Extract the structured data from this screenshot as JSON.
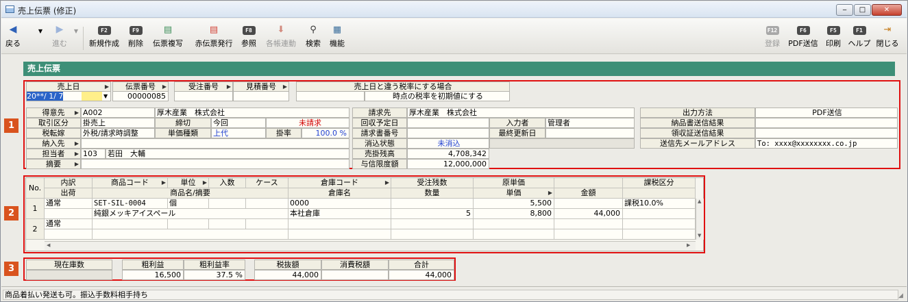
{
  "window": {
    "title": "売上伝票 (修正)",
    "min": "‒",
    "max": "□",
    "close": "✕"
  },
  "toolbar": {
    "back": "戻る",
    "forward": "進む",
    "new_key": "F2",
    "new": "新規作成",
    "delete_key": "F9",
    "delete": "削除",
    "copy": "伝票複写",
    "red": "赤伝票発行",
    "ref_key": "F8",
    "ref": "参照",
    "multi": "各帳連動",
    "search": "検索",
    "func": "機能",
    "register_key": "F12",
    "register": "登録",
    "pdf_key": "F6",
    "pdf": "PDF送信",
    "print_key": "F5",
    "print": "印刷",
    "help_key": "F1",
    "help": "ヘルプ",
    "close": "閉じる"
  },
  "header": {
    "title": "売上伝票"
  },
  "section1": {
    "sales_date_label": "売上日",
    "sales_date": "20**/ 1/ 7",
    "slip_no_label": "伝票番号",
    "slip_no": "00000085",
    "order_no_label": "受注番号",
    "order_no": "",
    "estimate_no_label": "見積番号",
    "estimate_no": "",
    "tax_rate_label": "売上日と違う税率にする場合",
    "tax_rate_value": "時点の税率を初期値にする"
  },
  "section1b": {
    "customer_label": "得意先",
    "customer_code": "A002",
    "customer_name": "厚木産業　株式会社",
    "trade_label": "取引区分",
    "trade": "掛売上",
    "closing_label": "締切",
    "closing": "今回",
    "unbilled": "未請求",
    "tax_label": "税転嫁",
    "tax": "外税/請求時調整",
    "price_type_label": "単価種類",
    "price_type": "上代",
    "rate_label": "掛率",
    "rate": "100.0 %",
    "delivery_label": "納入先",
    "delivery": "",
    "staff_label": "担当者",
    "staff_code": "103",
    "staff_name": "若田　大輔",
    "summary_label": "摘要",
    "summary": "",
    "bill_to_label": "請求先",
    "bill_to": "厚木産業　株式会社",
    "collect_label": "回収予定日",
    "collect": "",
    "invoice_label": "請求書番号",
    "invoice": "",
    "clear_label": "消込状態",
    "clear": "未消込",
    "ar_label": "売掛残高",
    "ar": "4,708,342",
    "credit_label": "与信限度額",
    "credit": "12,000,000",
    "entry_label": "入力者",
    "entry": "管理者",
    "updated_label": "最終更新日",
    "updated": "",
    "output_label": "出力方法",
    "output": "PDF送信",
    "delivery_result_label": "納品書送信結果",
    "delivery_result": "",
    "receipt_result_label": "領収証送信結果",
    "receipt_result": "",
    "mail_label": "送信先メールアドレス",
    "mail": "To: xxxx@xxxxxxxx.co.jp"
  },
  "grid": {
    "h1": [
      "No.",
      "内訳",
      "商品コード",
      "単位",
      "入数",
      "ケース",
      "倉庫コード",
      "受注残数",
      "原単価",
      "",
      "課税区分"
    ],
    "h2": [
      "出荷",
      "商品名/摘要",
      "倉庫名",
      "数量",
      "単価",
      "金額"
    ],
    "rows": [
      {
        "no": "1",
        "type": "通常",
        "code": "SET-SIL-0004",
        "unit": "個",
        "qty_per": "",
        "case": "",
        "wh_code": "0000",
        "order_rem": "",
        "cost": "5,500",
        "tax_kind": "課税10.0%",
        "ship": "",
        "name": "純銀メッキアイスペール",
        "wh_name": "本社倉庫",
        "qty": "5",
        "price": "8,800",
        "amount": "44,000"
      },
      {
        "no": "2",
        "type": "通常",
        "code": "",
        "unit": "",
        "qty_per": "",
        "case": "",
        "wh_code": "",
        "order_rem": "",
        "cost": "",
        "tax_kind": "",
        "ship": "",
        "name": "",
        "wh_name": "",
        "qty": "",
        "price": "",
        "amount": ""
      }
    ]
  },
  "totals": {
    "stock_label": "現在庫数",
    "stock": "",
    "gross_label": "粗利益",
    "gross": "16,500",
    "gross_rate_label": "粗利益率",
    "gross_rate": "37.5 %",
    "ex_tax_label": "税抜額",
    "ex_tax": "44,000",
    "tax_label": "消費税額",
    "tax": "",
    "total_label": "合計",
    "total": "44,000"
  },
  "badges": [
    "1",
    "2",
    "3"
  ],
  "status": {
    "text": "商品着払い発送も可。振込手数料相手持ち"
  }
}
